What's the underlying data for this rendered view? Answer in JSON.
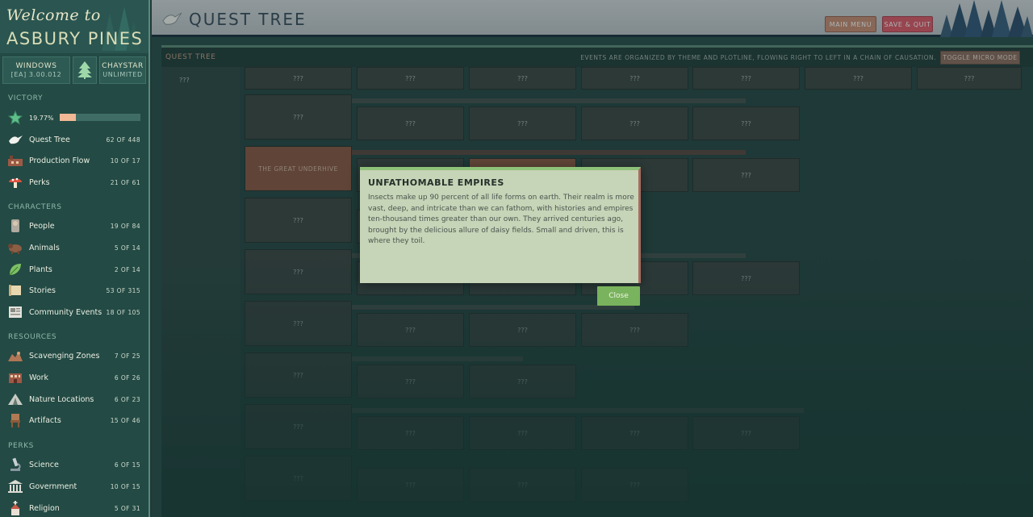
{
  "brand": {
    "welcome": "Welcome to",
    "town": "ASBURY PINES"
  },
  "info": {
    "platform": "WINDOWS",
    "version": "[EA] 3.00.012",
    "mode": "CHAYSTAR",
    "mode_sub": "UNLIMITED"
  },
  "sections": {
    "victory": "VICTORY",
    "characters": "CHARACTERS",
    "resources": "RESOURCES",
    "perks": "PERKS"
  },
  "victory": {
    "percent": "19.77%",
    "progress": 0.1977
  },
  "nav": {
    "progress": [
      {
        "label": "Quest Tree",
        "count": "62 OF 448",
        "icon": "dove-icon"
      },
      {
        "label": "Production Flow",
        "count": "10 OF 17",
        "icon": "factory-icon"
      },
      {
        "label": "Perks",
        "count": "21 OF 61",
        "icon": "mushroom-icon"
      }
    ],
    "characters": [
      {
        "label": "People",
        "count": "19 OF 84",
        "icon": "person-icon"
      },
      {
        "label": "Animals",
        "count": "5 OF 14",
        "icon": "animal-icon"
      },
      {
        "label": "Plants",
        "count": "2 OF 14",
        "icon": "leaf-icon"
      },
      {
        "label": "Stories",
        "count": "53 OF 315",
        "icon": "scroll-icon"
      },
      {
        "label": "Community Events",
        "count": "18 OF 105",
        "icon": "newspaper-icon"
      }
    ],
    "resources": [
      {
        "label": "Scavenging Zones",
        "count": "7 OF 25",
        "icon": "pile-icon"
      },
      {
        "label": "Work",
        "count": "6 OF 26",
        "icon": "building-icon"
      },
      {
        "label": "Nature Locations",
        "count": "6 OF 23",
        "icon": "tent-icon"
      },
      {
        "label": "Artifacts",
        "count": "15 OF 46",
        "icon": "chair-icon"
      }
    ],
    "perks": [
      {
        "label": "Science",
        "count": "6 OF 15",
        "icon": "microscope-icon"
      },
      {
        "label": "Government",
        "count": "10 OF 15",
        "icon": "capitol-icon"
      },
      {
        "label": "Religion",
        "count": "5 OF 31",
        "icon": "church-icon"
      }
    ]
  },
  "header": {
    "title": "QUEST TREE",
    "main_menu": "MAIN MENU",
    "save_quit": "SAVE & QUIT"
  },
  "tree": {
    "label": "QUEST TREE",
    "note": "EVENTS ARE ORGANIZED BY THEME AND PLOTLINE, FLOWING RIGHT TO LEFT IN A CHAIN OF CAUSATION.",
    "toggle": "TOGGLE MICRO MODE",
    "unknown": "???",
    "special_node": "THE GREAT UNDERHIVE"
  },
  "modal": {
    "title": "UNFATHOMABLE EMPIRES",
    "body": "Insects make up 90 percent of all life forms on earth. Their realm is more vast, deep, and intricate than we can fathom, with histories and empires ten-thousand times greater than our own. They arrived centuries ago, brought by the delicious allure of daisy fields. Small and driven, this is where they toil.",
    "close": "Close"
  },
  "colors": {
    "sidebar": "#234a44",
    "accent_green": "#79b35d",
    "save_red": "#e05868",
    "menu_tan": "#c98c74",
    "victory_fill": "#f0b894"
  }
}
